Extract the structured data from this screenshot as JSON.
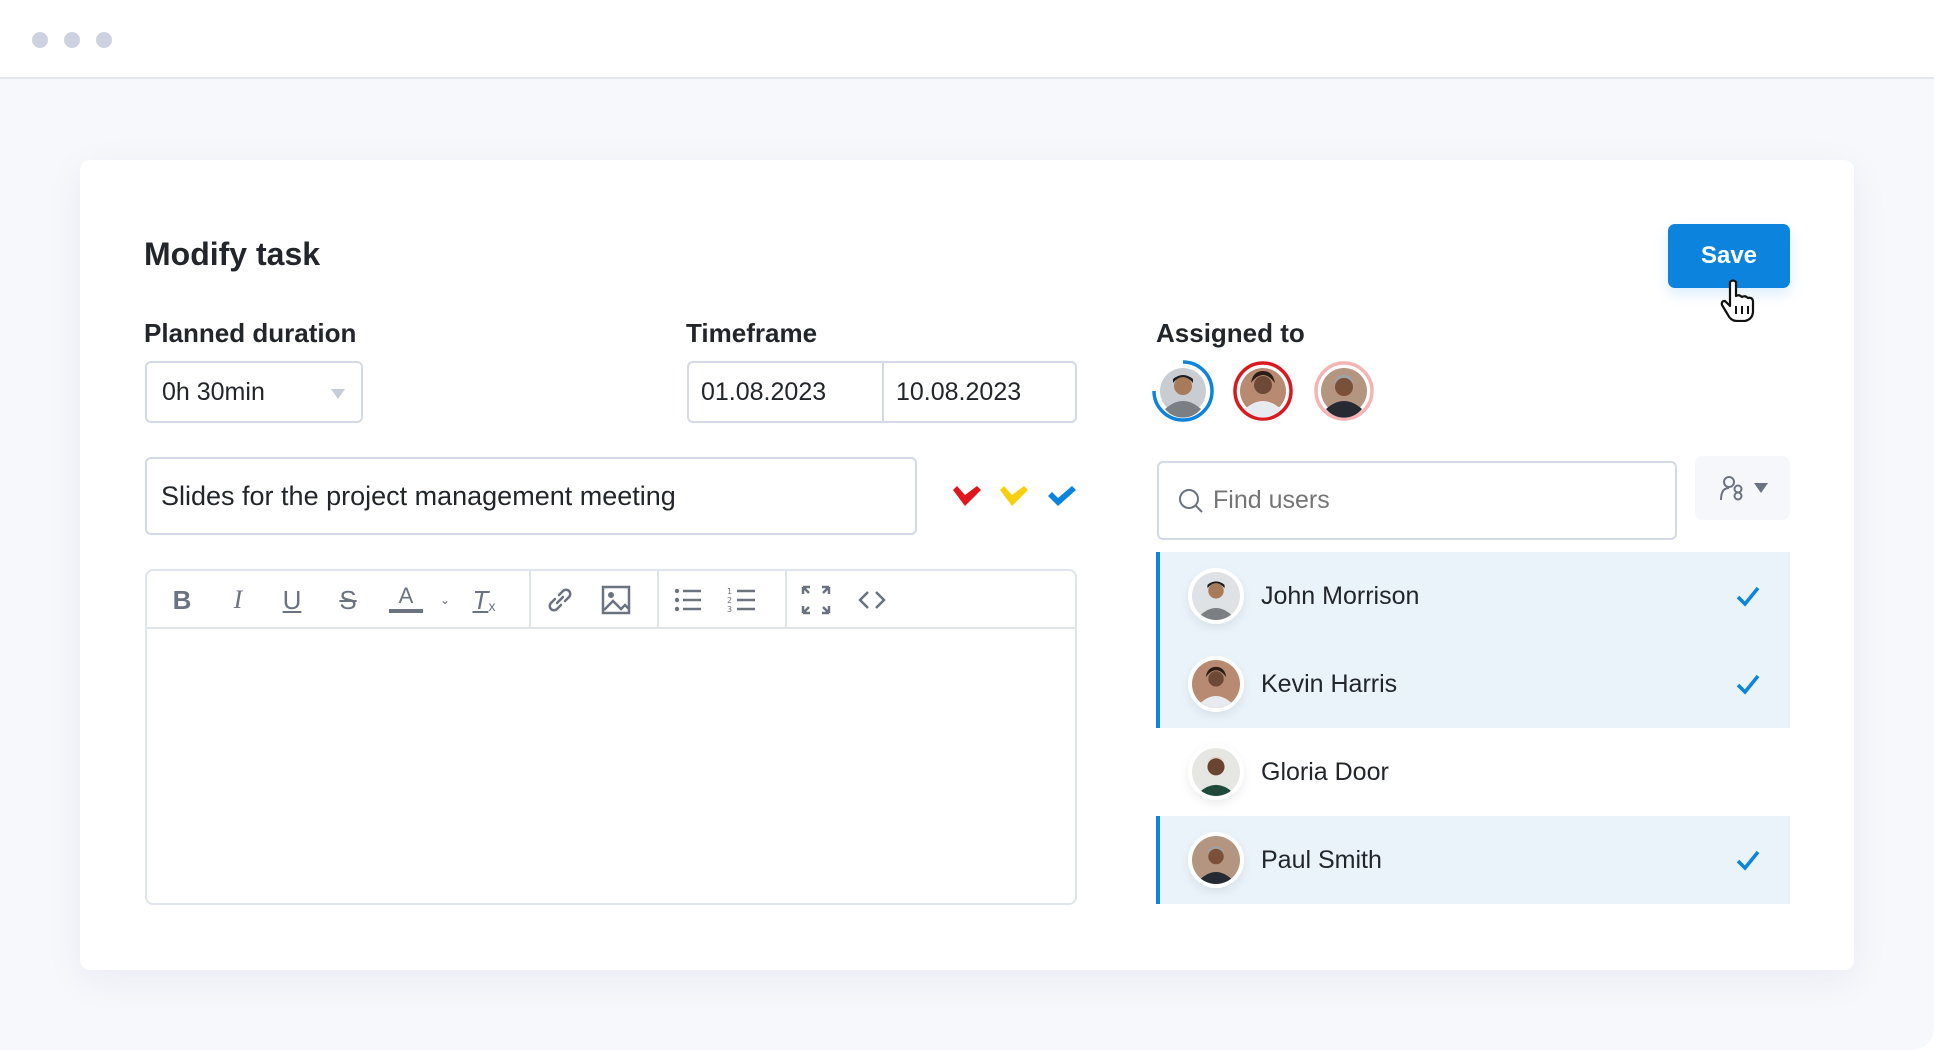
{
  "window": {
    "dots": [
      "window-dot-1",
      "window-dot-2",
      "window-dot-3"
    ]
  },
  "task": {
    "heading": "Modify task",
    "save_label": "Save",
    "planned_duration": {
      "label": "Planned duration",
      "value": "0h 30min"
    },
    "timeframe": {
      "label": "Timeframe",
      "start": "01.08.2023",
      "end": "10.08.2023"
    },
    "title_value": "Slides for the project management meeting",
    "priority_flags": [
      {
        "name": "red",
        "color": "#e0161e"
      },
      {
        "name": "yellow",
        "color": "#f7cf0e"
      },
      {
        "name": "blue",
        "color": "#0c84dd"
      }
    ],
    "editor_toolbar": [
      "bold",
      "italic",
      "underline",
      "strikethrough",
      "text-color",
      "text-color-dropdown",
      "clear-formatting",
      "link",
      "image",
      "bullet-list",
      "numbered-list",
      "fullscreen",
      "code"
    ],
    "editor_content": ""
  },
  "assigned": {
    "label": "Assigned to",
    "avatars": [
      {
        "user": "John Morrison",
        "ring_color": "#0c84dd",
        "progress": 0.75
      },
      {
        "user": "Kevin Harris",
        "ring_color": "#d81920",
        "progress": 1.0
      },
      {
        "user": "Paul Smith",
        "ring_color": "#f5b3b3",
        "progress": 1.0
      }
    ],
    "search_placeholder": "Find users",
    "users": [
      {
        "name": "John Morrison",
        "selected": true
      },
      {
        "name": "Kevin Harris",
        "selected": true
      },
      {
        "name": "Gloria Door",
        "selected": false
      },
      {
        "name": "Paul Smith",
        "selected": true
      }
    ]
  },
  "colors": {
    "accent": "#0c84dd",
    "selected_row_bg": "#eaf3fa"
  }
}
